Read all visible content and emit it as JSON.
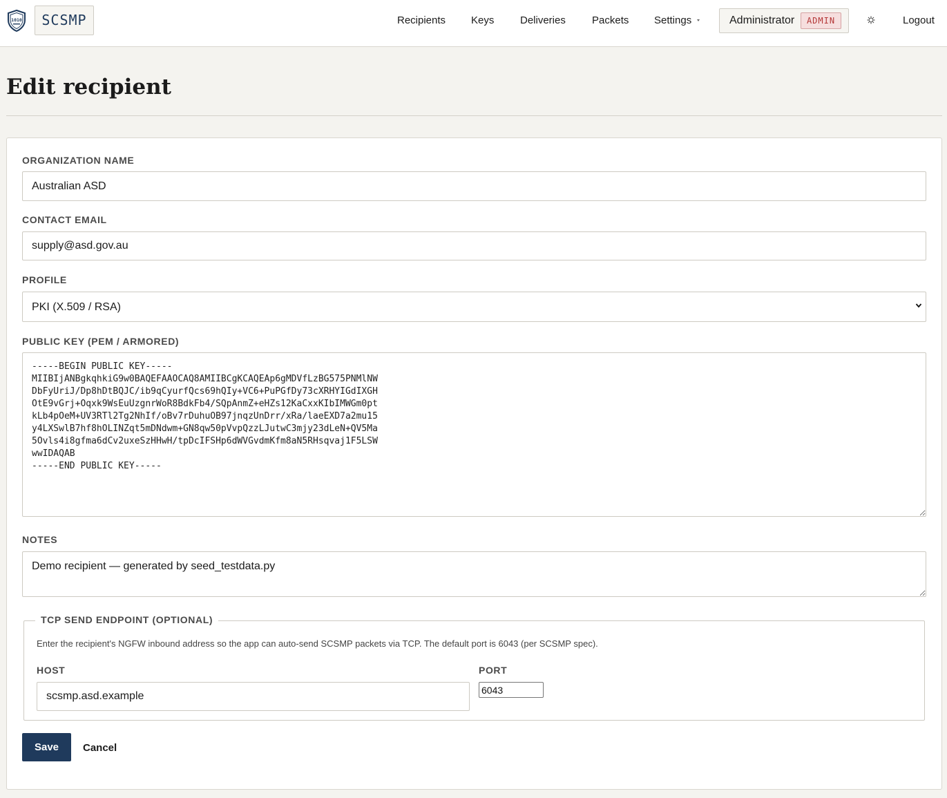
{
  "header": {
    "brand": "SCSMP",
    "nav": {
      "recipients": "Recipients",
      "keys": "Keys",
      "deliveries": "Deliveries",
      "packets": "Packets",
      "settings": "Settings"
    },
    "user": {
      "name": "Administrator",
      "role_badge": "ADMIN"
    },
    "logout": "Logout",
    "icons": {
      "logo": "shield-logo-icon",
      "theme": "theme-toggle-icon",
      "settings_caret": "caret-down-icon"
    }
  },
  "page": {
    "title": "Edit recipient"
  },
  "form": {
    "organization": {
      "label": "ORGANIZATION NAME",
      "value": "Australian ASD"
    },
    "email": {
      "label": "CONTACT EMAIL",
      "value": "supply@asd.gov.au"
    },
    "profile": {
      "label": "PROFILE",
      "selected": "PKI (X.509 / RSA)"
    },
    "public_key": {
      "label": "PUBLIC KEY (PEM / ARMORED)",
      "value": "-----BEGIN PUBLIC KEY-----\nMIIBIjANBgkqhkiG9w0BAQEFAAOCAQ8AMIIBCgKCAQEAp6gMDVfLzBG575PNMlNW\nDbFyUriJ/Dp8hDtBQJC/ib9qCyurfQcs69hQIy+VC6+PuPGfDy73cXRHYIGdIXGH\nOtE9vGrj+Oqxk9WsEuUzgnrWoR8BdkFb4/SQpAnmZ+eHZs12KaCxxKIbIMWGm0pt\nkLb4pOeM+UV3RTl2Tg2NhIf/oBv7rDuhuOB97jnqzUnDrr/xRa/laeEXD7a2mu15\ny4LXSwlB7hf8hOLINZqt5mDNdwm+GN8qw50pVvpQzzLJutwC3mjy23dLeN+QV5Ma\n5Ovls4i8gfma6dCv2uxeSzHHwH/tpDcIFSHp6dWVGvdmKfm8aN5RHsqvaj1F5LSW\nwwIDAQAB\n-----END PUBLIC KEY-----"
    },
    "notes": {
      "label": "NOTES",
      "value": "Demo recipient — generated by seed_testdata.py"
    },
    "tcp": {
      "legend": "TCP SEND ENDPOINT (OPTIONAL)",
      "help": "Enter the recipient's NGFW inbound address so the app can auto-send SCSMP packets via TCP. The default port is 6043 (per SCSMP spec).",
      "host_label": "HOST",
      "host_value": "scsmp.asd.example",
      "port_label": "PORT",
      "port_value": "6043"
    },
    "actions": {
      "save": "Save",
      "cancel": "Cancel"
    }
  }
}
